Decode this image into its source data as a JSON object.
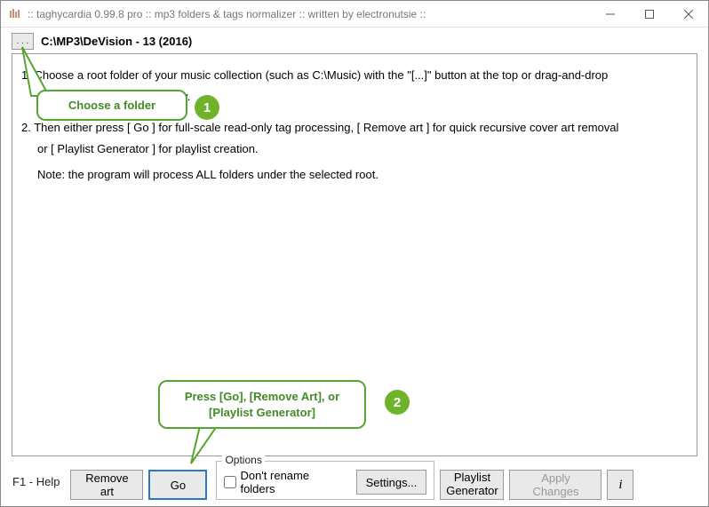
{
  "window": {
    "title": ":: taghycardia 0.99.8 pro :: mp3 folders & tags normalizer :: written by electronutsie ::"
  },
  "path": {
    "browse_label": ". . .",
    "current": "C:\\MP3\\DeVision - 13 (2016)"
  },
  "instructions": {
    "line1a": "1. Choose a root folder of your music collection (such as C:\\Music) with the \"[...]\" button at the top or drag-and-drop",
    "line1b": "one on the program's window.",
    "line2a": "2. Then either press [ Go ] for full-scale read-only tag processing, [ Remove art ] for quick recursive cover art removal",
    "line2b": "or [ Playlist Generator ] for playlist creation.",
    "note": "Note: the program will process ALL folders under the selected root."
  },
  "bottom": {
    "help": "F1 - Help",
    "remove_art": "Remove art",
    "go": "Go",
    "settings": "Settings...",
    "playlist": "Playlist\nGenerator",
    "apply": "Apply Changes",
    "info_icon": "i"
  },
  "options": {
    "legend": "Options",
    "dont_rename": "Don't rename folders"
  },
  "callouts": {
    "c1": "Choose a folder",
    "c2": "Press [Go], [Remove Art], or [Playlist Generator]",
    "b1": "1",
    "b2": "2"
  }
}
